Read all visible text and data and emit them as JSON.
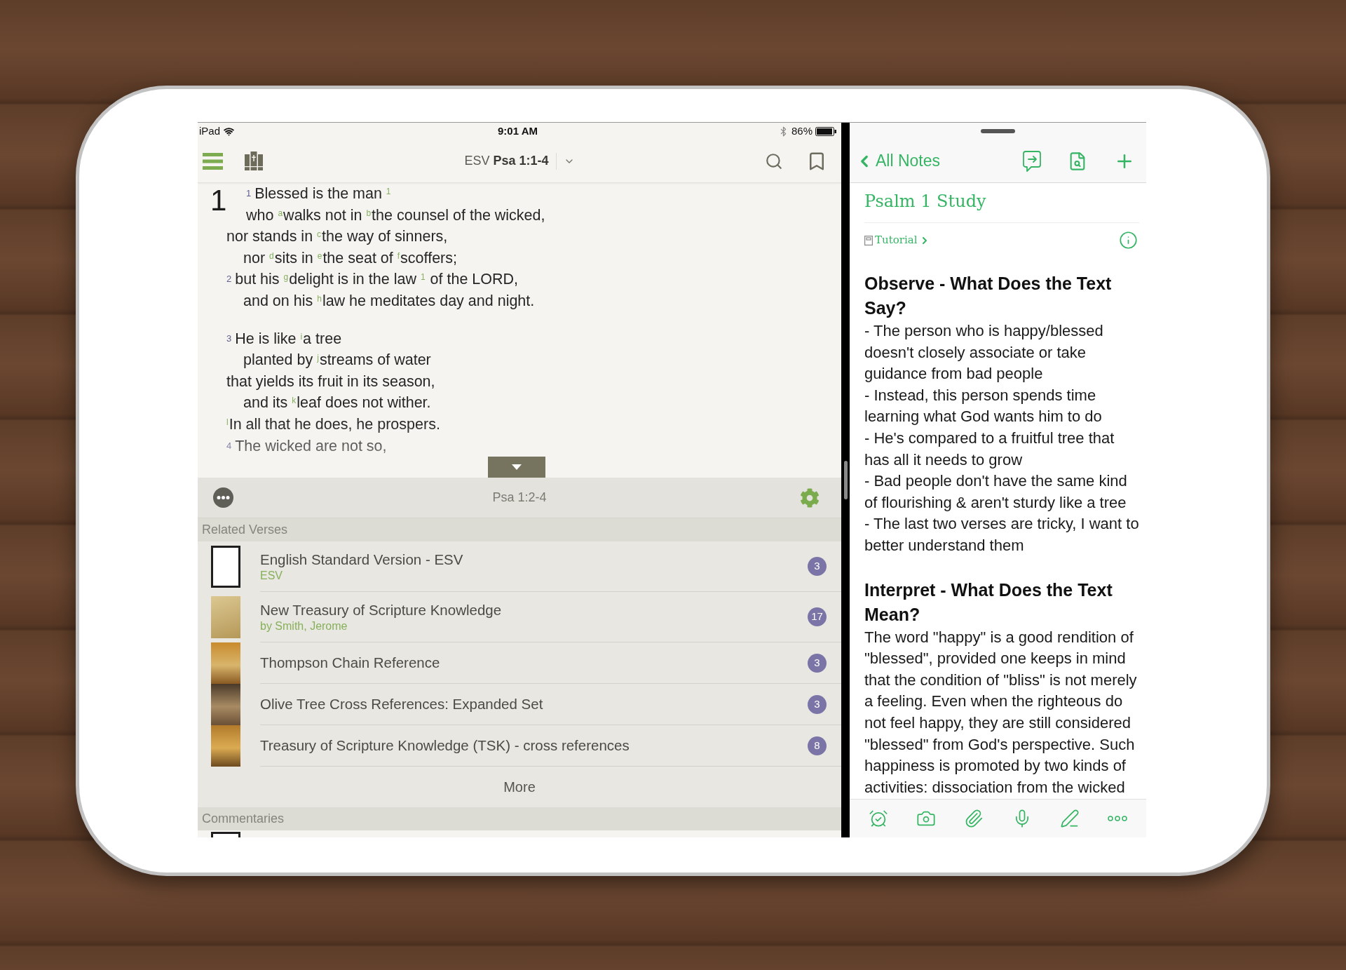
{
  "status_bar": {
    "device": "iPad",
    "time": "9:01 AM",
    "battery": "86%"
  },
  "bible_pane": {
    "title": "ESV **Psa 1:1-4**",
    "chapter": "1",
    "stanzas": [
      {
        "lines": [
          {
            "kind": "outer",
            "verse": "1",
            "text": "Blessed is the man $^{1}$"
          },
          {
            "kind": "inner",
            "text": "who $^{a}$walks not in $^{b}$the counsel of the wicked,"
          },
          {
            "kind": "outer",
            "text": "nor stands in $^{c}$the way of sinners,"
          },
          {
            "kind": "inner",
            "text": "nor $^{d}$sits in $^{e}$the seat of $^{f}$scoffers;"
          },
          {
            "kind": "outer",
            "verse": "2",
            "text": "but his $^{g}$delight is in the law $^{1}$ of the LORD,"
          },
          {
            "kind": "inner",
            "text": "and on his $^{h}$law he meditates day and night."
          }
        ]
      },
      {
        "lines": [
          {
            "kind": "outer",
            "verse": "3",
            "text": "He is like $^{i}$a tree"
          },
          {
            "kind": "inner",
            "text": "planted by $^{j}$streams of water"
          },
          {
            "kind": "outer",
            "text": "that yields its fruit in its season,"
          },
          {
            "kind": "inner",
            "text": "and its $^{k}$leaf does not wither."
          },
          {
            "kind": "outer",
            "text": "$^{l}$In all that he does, he prospers."
          },
          {
            "kind": "outer",
            "verse": "4",
            "text": "The wicked are not so,"
          }
        ]
      }
    ]
  },
  "reference_panel": {
    "title": "Psa 1:2-4",
    "sections": [
      {
        "title": "Related Verses",
        "items": [
          {
            "title": "English Standard Version - ESV",
            "subtitle": "ESV",
            "count": "3"
          },
          {
            "title": "New Treasury of Scripture Knowledge",
            "subtitle": "by Smith, Jerome",
            "count": "17"
          },
          {
            "title": "Thompson Chain Reference",
            "count": "3"
          },
          {
            "title": "Olive Tree Cross References: Expanded Set",
            "count": "3"
          },
          {
            "title": "Treasury of Scripture Knowledge (TSK) - cross references",
            "count": "8"
          }
        ],
        "more": "More"
      },
      {
        "title": "Commentaries",
        "items": [
          {
            "kind": "cover_only"
          }
        ]
      }
    ]
  },
  "notes_pane": {
    "back": "All Notes",
    "title": "Psalm 1 Study",
    "notebook": "Tutorial",
    "sections": [
      {
        "heading": "Observe - What Does the Text Say?",
        "paragraphs": [
          "- The person who is happy/blessed doesn't closely associate or take guidance from bad people",
          "- Instead, this person spends time learning what God wants him to do",
          "- He's compared to a fruitful tree that has all it needs to grow",
          "- Bad people don't have the same kind of flourishing & aren't sturdy like a tree",
          "- The last two verses are tricky, I want to better understand them"
        ]
      },
      {
        "heading": "Interpret - What Does the Text Mean?",
        "paragraphs": [
          "The word \"happy\" is a good rendition of \"blessed\", provided one keeps in mind that the condition of \"bliss\" is not merely a feeling. Even when the righteous do not feel happy, they are still considered \"blessed\" from God's perspective. Such happiness is promoted by two kinds of activities: dissociation from the wicked"
        ]
      }
    ]
  }
}
